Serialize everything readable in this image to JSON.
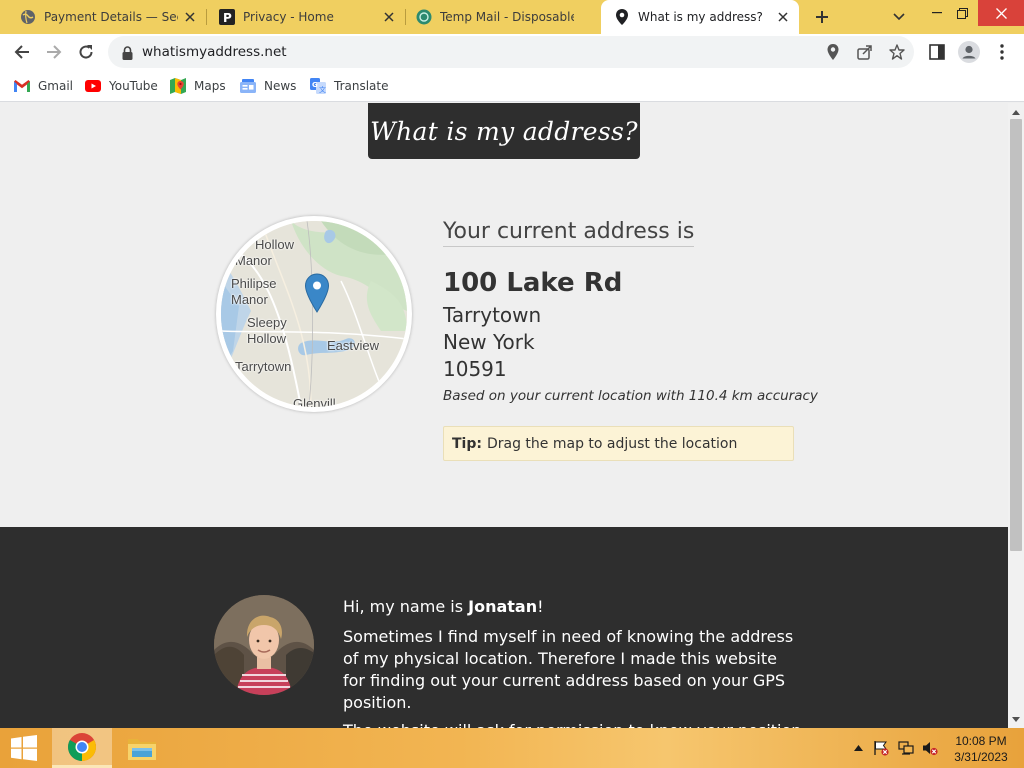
{
  "browser": {
    "tabs": [
      {
        "title": "Payment Details — Secur",
        "icon": "globe-icon",
        "active": false
      },
      {
        "title": "Privacy - Home",
        "icon": "p-logo-icon",
        "active": false
      },
      {
        "title": "Temp Mail - Disposable T",
        "icon": "temp-mail-icon",
        "active": false
      },
      {
        "title": "What is my address?",
        "icon": "location-pin-icon",
        "active": true
      }
    ],
    "url": "whatismyaddress.net",
    "bookmarks": [
      {
        "label": "Gmail",
        "icon": "gmail-icon"
      },
      {
        "label": "YouTube",
        "icon": "youtube-icon"
      },
      {
        "label": "Maps",
        "icon": "maps-icon"
      },
      {
        "label": "News",
        "icon": "news-icon"
      },
      {
        "label": "Translate",
        "icon": "translate-icon"
      }
    ]
  },
  "page": {
    "logo": "What is my address?",
    "map_labels": [
      "Hollow",
      "Manor",
      "Philipse",
      "Manor",
      "Sleepy",
      "Hollow",
      "Eastview",
      "Tarrytown",
      "Glenvill"
    ],
    "heading": "Your current address is",
    "street": "100 Lake Rd",
    "city": "Tarrytown",
    "state": "New York",
    "zip": "10591",
    "accuracy": "Based on your current location with 110.4 km accuracy",
    "tip_label": "Tip:",
    "tip_text": "Drag the map to adjust the location",
    "about": {
      "greeting_prefix": "Hi, my name is ",
      "name": "Jonatan",
      "greeting_suffix": "!",
      "paragraph": "Sometimes I find myself in need of knowing the address of my physical location. Therefore I made this website for finding out your current address based on your GPS position.",
      "paragraph2": "The website will ask for permission to know your position"
    }
  },
  "taskbar": {
    "time": "10:08 PM",
    "date": "3/31/2023"
  },
  "colors": {
    "tab_strip": "#f0cf60",
    "dark_section": "#2e2e2e",
    "tip_bg": "#fcf3d6",
    "pin": "#3a87c8"
  }
}
